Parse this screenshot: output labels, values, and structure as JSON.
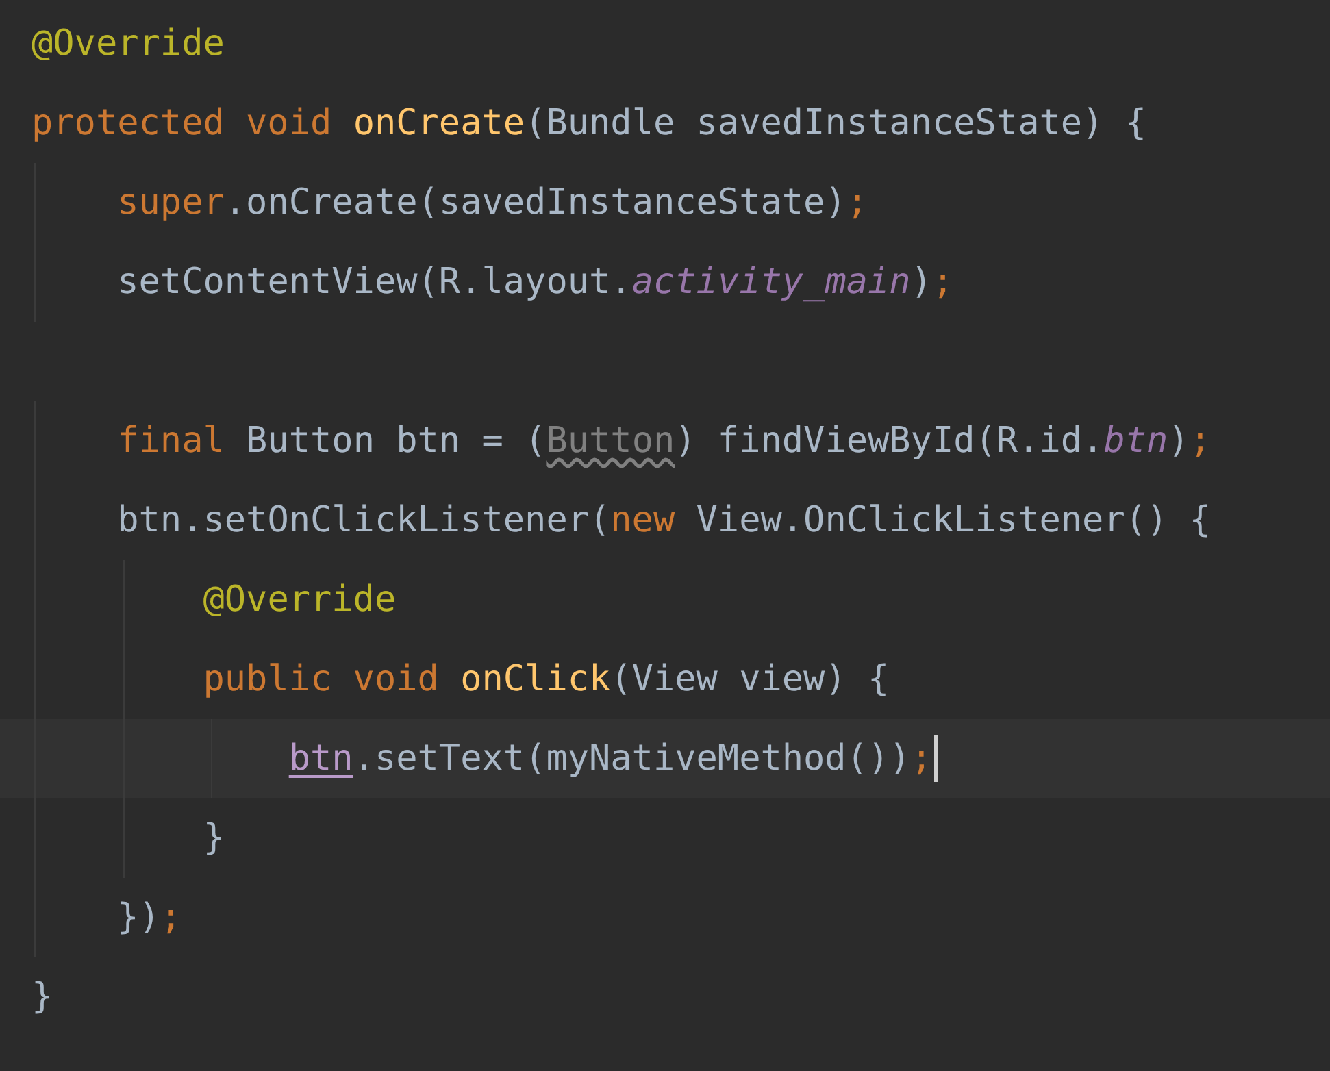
{
  "lines": [
    {
      "current": false,
      "tokens": [
        {
          "kind": "annotation",
          "text": "@Override"
        }
      ]
    },
    {
      "current": false,
      "tokens": [
        {
          "kind": "keyword",
          "text": "protected void "
        },
        {
          "kind": "declaration",
          "text": "onCreate"
        },
        {
          "kind": "plain",
          "text": "(Bundle savedInstanceState) {"
        }
      ]
    },
    {
      "current": false,
      "tokens": [
        {
          "kind": "keyword",
          "text": "    super"
        },
        {
          "kind": "plain",
          "text": ".onCreate(savedInstanceState)"
        },
        {
          "kind": "keyword",
          "text": ";"
        }
      ]
    },
    {
      "current": false,
      "tokens": [
        {
          "kind": "plain",
          "text": "    setContentView(R.layout."
        },
        {
          "kind": "static",
          "text": "activity_main"
        },
        {
          "kind": "plain",
          "text": ")"
        },
        {
          "kind": "keyword",
          "text": ";"
        }
      ]
    },
    {
      "current": false
    },
    {
      "current": false,
      "tokens": [
        {
          "kind": "keyword",
          "text": "    final "
        },
        {
          "kind": "plain",
          "text": "Button btn = ("
        },
        {
          "kind": "redundant",
          "text": "Button"
        },
        {
          "kind": "plain",
          "text": ") findViewById(R.id."
        },
        {
          "kind": "static",
          "text": "btn"
        },
        {
          "kind": "plain",
          "text": ")"
        },
        {
          "kind": "keyword",
          "text": ";"
        }
      ]
    },
    {
      "current": false,
      "tokens": [
        {
          "kind": "plain",
          "text": "    btn.setOnClickListener("
        },
        {
          "kind": "keyword",
          "text": "new "
        },
        {
          "kind": "plain",
          "text": "View.OnClickListener() {"
        }
      ]
    },
    {
      "current": false,
      "tokens": [
        {
          "kind": "annotation",
          "text": "        @Override"
        }
      ]
    },
    {
      "current": false,
      "tokens": [
        {
          "kind": "keyword",
          "text": "        public void "
        },
        {
          "kind": "declaration",
          "text": "onClick"
        },
        {
          "kind": "plain",
          "text": "(View view) {"
        }
      ]
    },
    {
      "current": true,
      "tokens": [
        {
          "kind": "captured",
          "text": "            btn"
        },
        {
          "kind": "plain",
          "text": ".setText(myNativeMethod())"
        },
        {
          "kind": "keyword",
          "text": ";"
        }
      ]
    },
    {
      "current": false,
      "tokens": [
        {
          "kind": "plain",
          "text": "        }"
        }
      ]
    },
    {
      "current": false,
      "tokens": [
        {
          "kind": "plain",
          "text": "    })"
        },
        {
          "kind": "keyword",
          "text": ";"
        }
      ]
    },
    {
      "current": false,
      "tokens": [
        {
          "kind": "plain",
          "text": "}"
        }
      ]
    }
  ]
}
